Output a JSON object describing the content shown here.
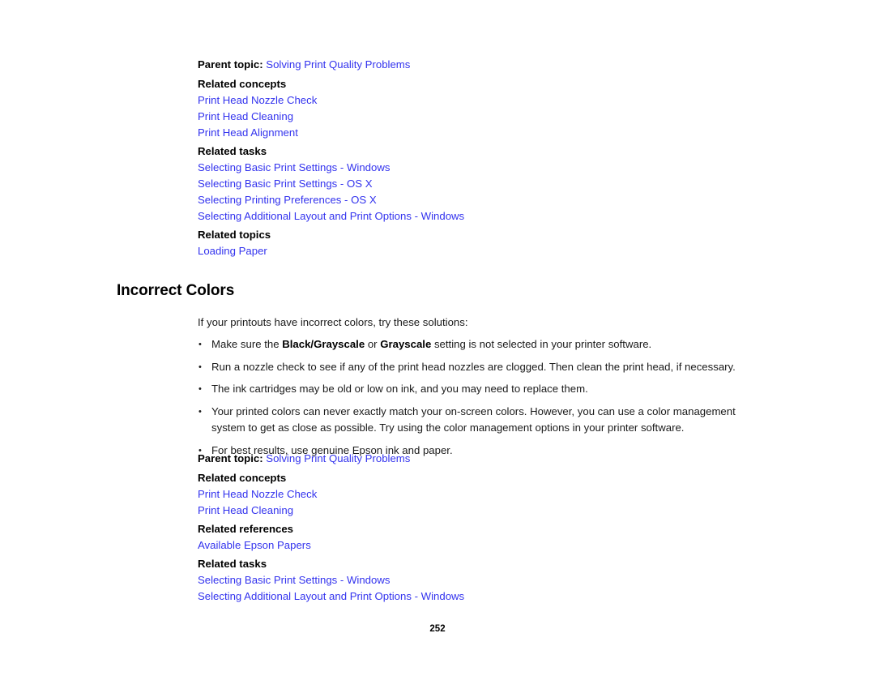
{
  "page": {
    "number": "252"
  },
  "top_related": {
    "parent_topic": {
      "label": "Parent topic:",
      "link": "Solving Print Quality Problems"
    },
    "groups": [
      {
        "heading": "Related concepts",
        "links": [
          "Print Head Nozzle Check",
          "Print Head Cleaning",
          "Print Head Alignment"
        ]
      },
      {
        "heading": "Related tasks",
        "links": [
          "Selecting Basic Print Settings - Windows",
          "Selecting Basic Print Settings - OS X",
          "Selecting Printing Preferences - OS X",
          "Selecting Additional Layout and Print Options - Windows"
        ]
      },
      {
        "heading": "Related topics",
        "links": [
          "Loading Paper"
        ]
      }
    ]
  },
  "section": {
    "heading": "Incorrect Colors",
    "intro": "If your printouts have incorrect colors, try these solutions:",
    "bullets": [
      {
        "parts": [
          {
            "text": "Make sure the ",
            "bold": false
          },
          {
            "text": "Black/Grayscale",
            "bold": true
          },
          {
            "text": " or ",
            "bold": false
          },
          {
            "text": "Grayscale",
            "bold": true
          },
          {
            "text": " setting is not selected in your printer software.",
            "bold": false
          }
        ]
      },
      {
        "parts": [
          {
            "text": "Run a nozzle check to see if any of the print head nozzles are clogged. Then clean the print head, if necessary.",
            "bold": false
          }
        ]
      },
      {
        "parts": [
          {
            "text": "The ink cartridges may be old or low on ink, and you may need to replace them.",
            "bold": false
          }
        ]
      },
      {
        "parts": [
          {
            "text": "Your printed colors can never exactly match your on-screen colors. However, you can use a color management system to get as close as possible. Try using the color management options in your printer software.",
            "bold": false
          }
        ]
      },
      {
        "parts": [
          {
            "text": "For best results, use genuine Epson ink and paper.",
            "bold": false
          }
        ]
      }
    ]
  },
  "bottom_related": {
    "parent_topic": {
      "label": "Parent topic:",
      "link": "Solving Print Quality Problems"
    },
    "groups": [
      {
        "heading": "Related concepts",
        "links": [
          "Print Head Nozzle Check",
          "Print Head Cleaning"
        ]
      },
      {
        "heading": "Related references",
        "links": [
          "Available Epson Papers"
        ]
      },
      {
        "heading": "Related tasks",
        "links": [
          "Selecting Basic Print Settings - Windows",
          "Selecting Additional Layout and Print Options - Windows"
        ]
      }
    ]
  },
  "colors": {
    "link": "#3333ee",
    "text": "#1a1a1a",
    "background": "#ffffff"
  }
}
